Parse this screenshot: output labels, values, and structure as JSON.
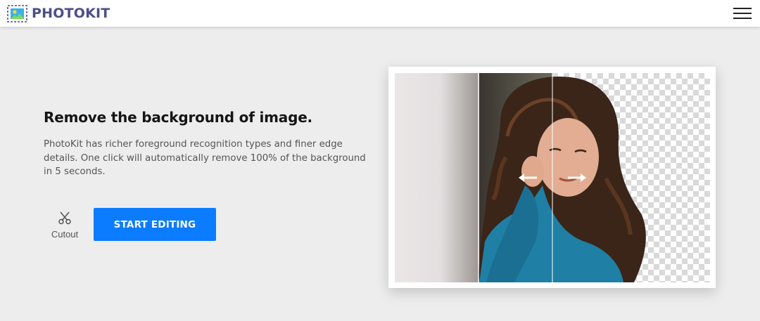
{
  "header": {
    "brand": "PHOTOKIT",
    "logo_icon": "photo-frame-icon",
    "menu_icon": "hamburger-menu-icon"
  },
  "hero": {
    "title": "Remove the background of image.",
    "description": "PhotoKit has richer foreground recognition types and finer edge details. One click will automatically remove 100% of the background in 5 seconds.",
    "tool": {
      "label": "Cutout",
      "icon": "scissors-icon"
    },
    "cta_label": "START EDITING"
  },
  "preview": {
    "left_arrow_icon": "arrow-left-icon",
    "right_arrow_icon": "arrow-right-icon"
  },
  "colors": {
    "brand": "#4b4f88",
    "accent": "#0b7cff",
    "background": "#ededed"
  }
}
